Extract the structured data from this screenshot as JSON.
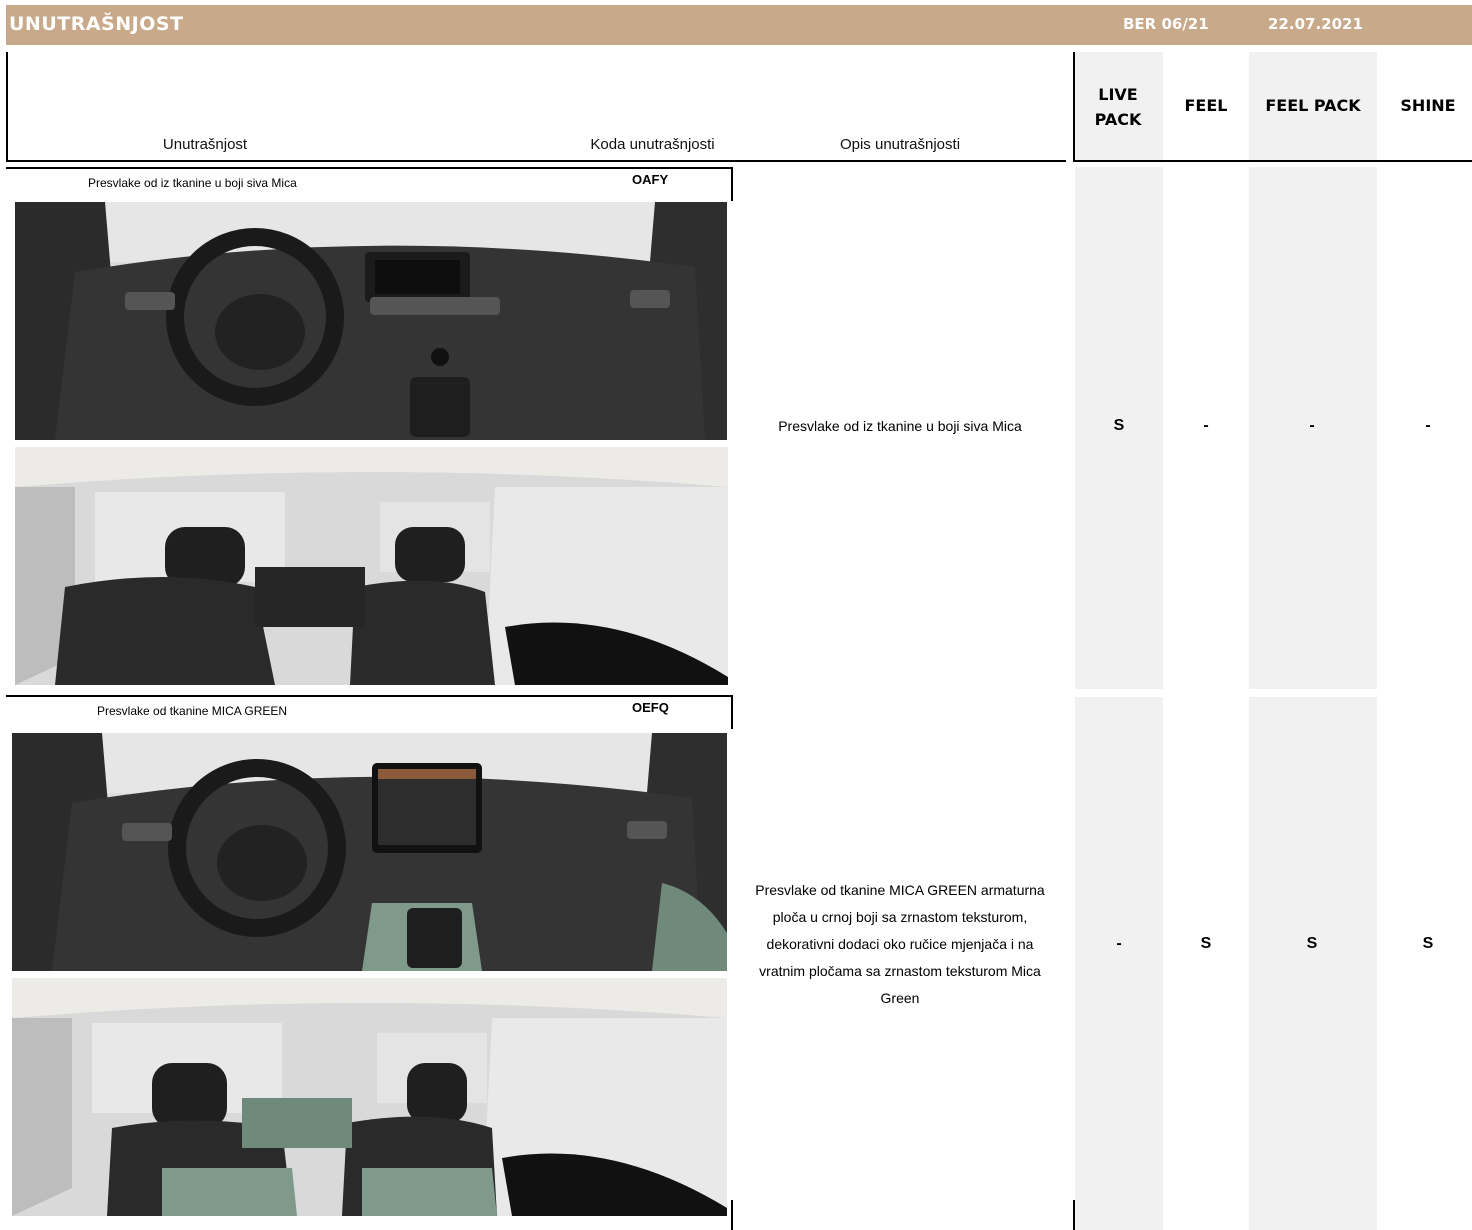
{
  "header": {
    "title": "UNUTRAŠNJOST",
    "version": "BER 06/21",
    "date": "22.07.2021"
  },
  "columns": {
    "interior": "Unutrašnjost",
    "code": "Koda unutrašnjosti",
    "description": "Opis unutrašnjosti",
    "grades": [
      "LIVE PACK",
      "FEEL",
      "FEEL PACK",
      "SHINE"
    ]
  },
  "rows": [
    {
      "label": "Presvlake od iz tkanine u boji siva Mica",
      "code": "OAFY",
      "description": "Presvlake od iz tkanine u boji siva Mica",
      "availability": [
        "S",
        "-",
        "-",
        "-"
      ]
    },
    {
      "label": "Presvlake od tkanine MICA GREEN",
      "code": "OEFQ",
      "description": "Presvlake od tkanine MICA GREEN armaturna ploča u crnoj boji sa zrnastom teksturom, dekorativni dodaci oko ručice mjenjača i na vratnim pločama sa zrnastom teksturom Mica Green",
      "availability": [
        "-",
        "S",
        "S",
        "S"
      ]
    }
  ]
}
